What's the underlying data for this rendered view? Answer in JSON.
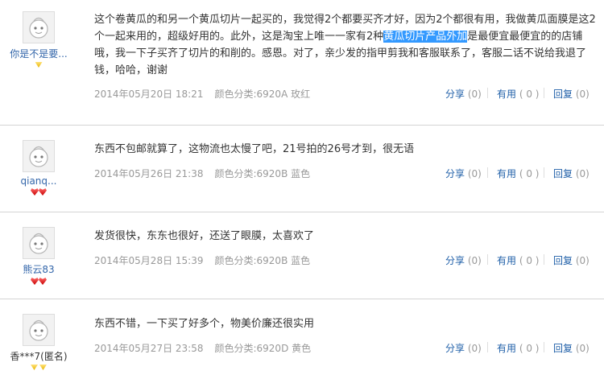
{
  "labels": {
    "share": "分享",
    "useful": "有用",
    "reply": "回复"
  },
  "reviews": [
    {
      "user": "你是不是要...",
      "badge": "gold1",
      "content_pre": "这个卷黄瓜的和另一个黄瓜切片一起买的，我觉得2个都要买齐才好，因为2个都很有用，我做黄瓜面膜是这2个一起来用的，超级好用的。此外，这是淘宝上唯一一家有2种",
      "content_hl": "黄瓜切片产品外加",
      "content_post": "是最便宜最便宜的的店铺哦，我一下子买齐了切片的和削的。感恩。对了，亲少发的指甲剪我和客服联系了，客服二话不说给我退了钱，哈哈，谢谢",
      "date": "2014年05月20日 18:21",
      "sku": "颜色分类:6920A 玫红",
      "share_count": "(0)",
      "useful_count": "( 0 )",
      "reply_count": "(0)"
    },
    {
      "user": "qianq...",
      "badge": "heart2",
      "content": "东西不包邮就算了，这物流也太慢了吧，21号拍的26号才到，很无语",
      "date": "2014年05月26日 21:38",
      "sku": "颜色分类:6920B 蓝色",
      "share_count": "(0)",
      "useful_count": "( 0 )",
      "reply_count": "(0)"
    },
    {
      "user": "熊云83",
      "badge": "heart2",
      "content": "发货很快，东东也很好，还送了眼膜，太喜欢了",
      "date": "2014年05月28日 15:39",
      "sku": "颜色分类:6920B 蓝色",
      "share_count": "(0)",
      "useful_count": "( 0 )",
      "reply_count": "(0)"
    },
    {
      "user": "香***7(匿名)",
      "badge": "gold2",
      "content": "东西不错，一下买了好多个，物美价廉还很实用",
      "date": "2014年05月27日 23:58",
      "sku": "颜色分类:6920D 黄色",
      "share_count": "(0)",
      "useful_count": "( 0 )",
      "reply_count": "(0)"
    }
  ]
}
